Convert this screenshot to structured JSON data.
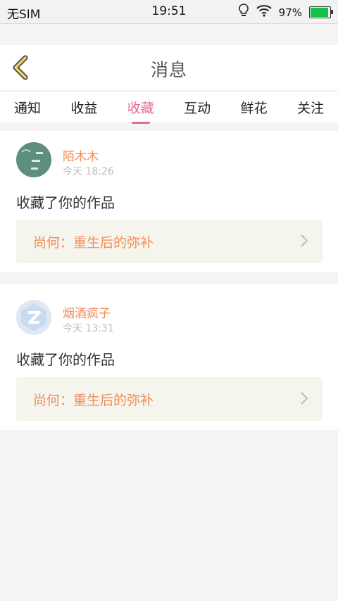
{
  "status_bar": {
    "carrier": "无SIM",
    "time": "19:51",
    "battery": "97%"
  },
  "header": {
    "title": "消息"
  },
  "tabs": [
    {
      "label": "通知"
    },
    {
      "label": "收益"
    },
    {
      "label": "收藏"
    },
    {
      "label": "互动"
    },
    {
      "label": "鲜花"
    },
    {
      "label": "关注"
    }
  ],
  "active_tab": "收藏",
  "messages": [
    {
      "user": "陌木木",
      "time": "今天 18:26",
      "text": "收藏了你的作品",
      "work": "尚何：重生后的弥补"
    },
    {
      "user": "烟酒疯子",
      "time": "今天 13:31",
      "text": "收藏了你的作品",
      "work": "尚何：重生后的弥补"
    }
  ],
  "colors": {
    "accent_pink": "#e76996",
    "name_orange": "#f08d5b",
    "battery_green": "#12c24a"
  }
}
